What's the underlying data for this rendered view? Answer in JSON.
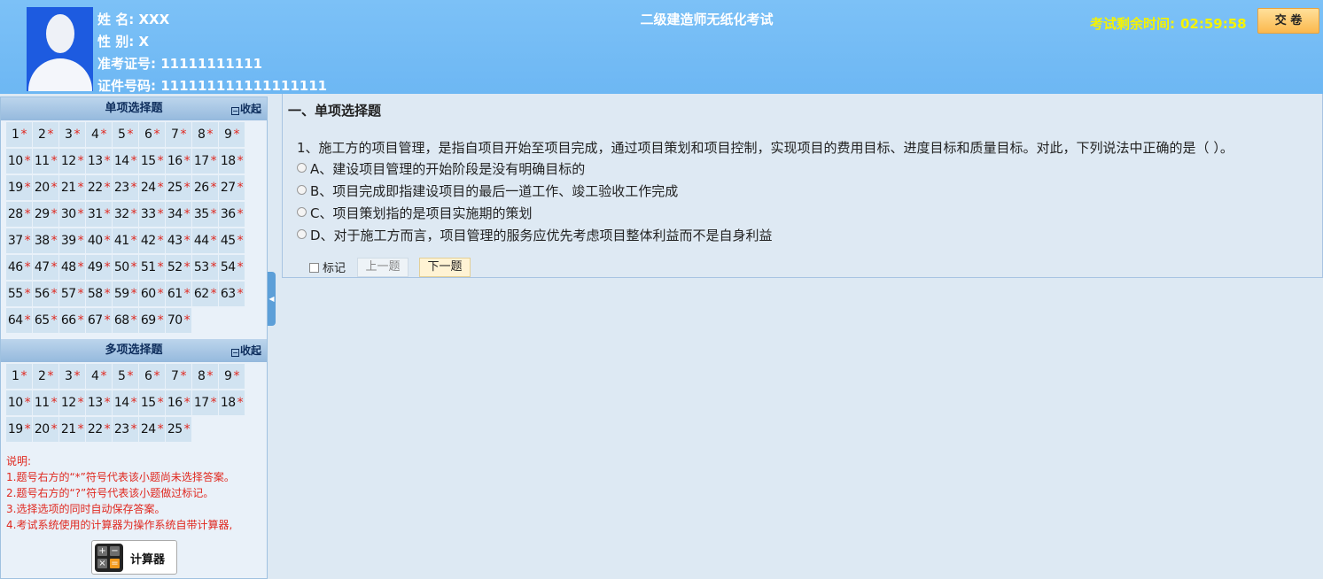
{
  "exam_title": "二级建造师无纸化考试",
  "candidate": {
    "name_label": "姓 名:",
    "name": "XXX",
    "gender_label": "性 别:",
    "gender": "X",
    "ticket_label": "准考证号:",
    "ticket": "11111111111",
    "id_label": "证件号码:",
    "id": "111111111111111111"
  },
  "timer": {
    "label": "考试剩余时间:",
    "value": "02:59:58"
  },
  "submit_label": "交 卷",
  "sidebar": {
    "single": {
      "title": "单项选择题",
      "collapse_label": "收起",
      "items": [
        "1",
        "2",
        "3",
        "4",
        "5",
        "6",
        "7",
        "8",
        "9",
        "10",
        "11",
        "12",
        "13",
        "14",
        "15",
        "16",
        "17",
        "18",
        "19",
        "20",
        "21",
        "22",
        "23",
        "24",
        "25",
        "26",
        "27",
        "28",
        "29",
        "30",
        "31",
        "32",
        "33",
        "34",
        "35",
        "36",
        "37",
        "38",
        "39",
        "40",
        "41",
        "42",
        "43",
        "44",
        "45",
        "46",
        "47",
        "48",
        "49",
        "50",
        "51",
        "52",
        "53",
        "54",
        "55",
        "56",
        "57",
        "58",
        "59",
        "60",
        "61",
        "62",
        "63",
        "64",
        "65",
        "66",
        "67",
        "68",
        "69",
        "70"
      ]
    },
    "multi": {
      "title": "多项选择题",
      "collapse_label": "收起",
      "items": [
        "1",
        "2",
        "3",
        "4",
        "5",
        "6",
        "7",
        "8",
        "9",
        "10",
        "11",
        "12",
        "13",
        "14",
        "15",
        "16",
        "17",
        "18",
        "19",
        "20",
        "21",
        "22",
        "23",
        "24",
        "25"
      ]
    },
    "unanswered_marker": "*",
    "legend": [
      "说明:",
      "1.题号右方的“*”符号代表该小题尚未选择答案。",
      "2.题号右方的“?”符号代表该小题做过标记。",
      "3.选择选项的同时自动保存答案。",
      "4.考试系统使用的计算器为操作系统自带计算器,"
    ],
    "calculator_label": "计算器"
  },
  "question": {
    "section": "一、单项选择题",
    "text": "1、施工方的项目管理，是指自项目开始至项目完成，通过项目策划和项目控制，实现项目的费用目标、进度目标和质量目标。对此，下列说法中正确的是（    ）。",
    "options": [
      "A、建设项目管理的开始阶段是没有明确目标的",
      "B、项目完成即指建设项目的最后一道工作、竣工验收工作完成",
      "C、项目策划指的是项目实施期的策划",
      "D、对于施工方而言，项目管理的服务应优先考虑项目整体利益而不是自身利益"
    ],
    "mark_label": "标记",
    "prev_label": "上一题",
    "next_label": "下一题"
  },
  "colors": {
    "header_bg": "#74bcf5",
    "timer": "#f6f300",
    "unanswered_star": "#e0281f",
    "cell_bg": "#d1e3f1"
  }
}
